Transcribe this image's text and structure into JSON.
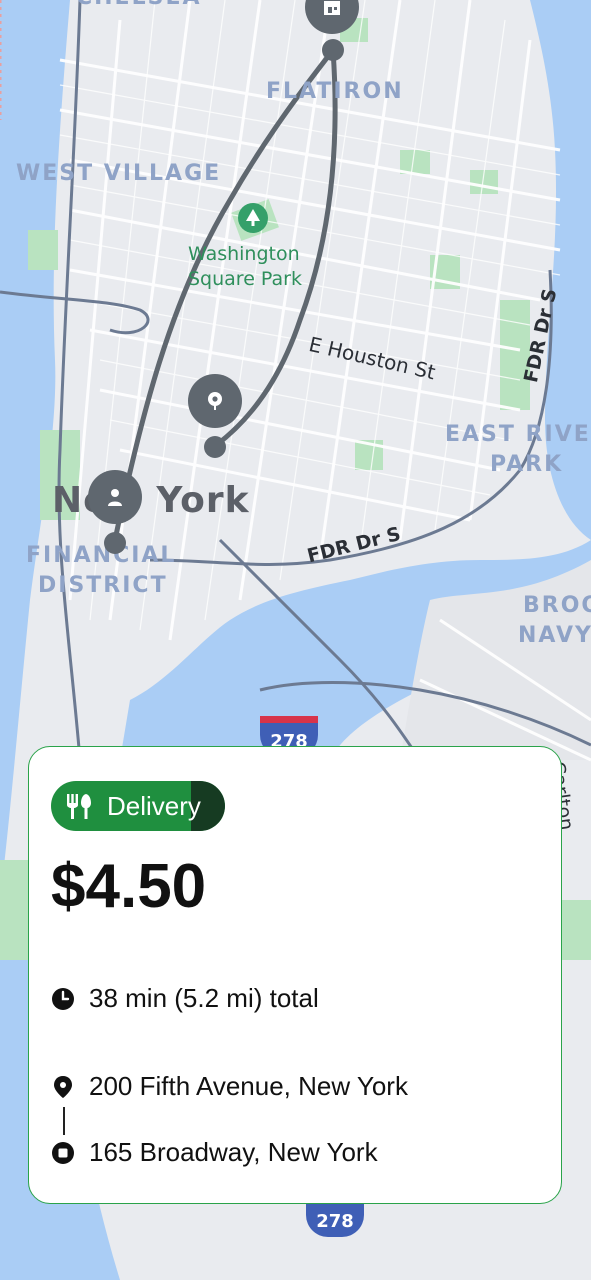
{
  "map": {
    "neighborhoods": {
      "chelsea": "CHELSEA",
      "flatiron": "FLATIRON",
      "west_village": "WEST VILLAGE",
      "financial_district_line1": "FINANCIAL",
      "financial_district_line2": "DISTRICT",
      "east_river_park_line1": "EAST RIVE",
      "east_river_park_line2": "PARK",
      "brooklyn_navy_line1": "BROO",
      "brooklyn_navy_line2": "NAVY"
    },
    "park": {
      "line1": "Washington",
      "line2": "Square Park"
    },
    "streets": {
      "e_houston": "E Houston St",
      "fdr_vertical": "FDR Dr S",
      "fdr_horizontal": "FDR Dr S",
      "carlton": "Carlton"
    },
    "city": "New York",
    "highway_shields": [
      "278",
      "278"
    ],
    "colors": {
      "land": "#e9ebef",
      "water": "#aacdf5",
      "park": "#b9e3c0",
      "road": "#ffffff",
      "highway": "#6c7a92",
      "route": "#5f676f"
    }
  },
  "card": {
    "badge_label": "Delivery",
    "badge_icon": "utensils-icon",
    "price": "$4.50",
    "duration": "38 min (5.2 mi) total",
    "pickup_address": "200 Fifth Avenue, New York",
    "dropoff_address": "165 Broadway, New York",
    "colors": {
      "accent": "#1f8f3f",
      "accent_dark": "#163b22",
      "border": "#2aa34a",
      "text": "#111111"
    }
  }
}
